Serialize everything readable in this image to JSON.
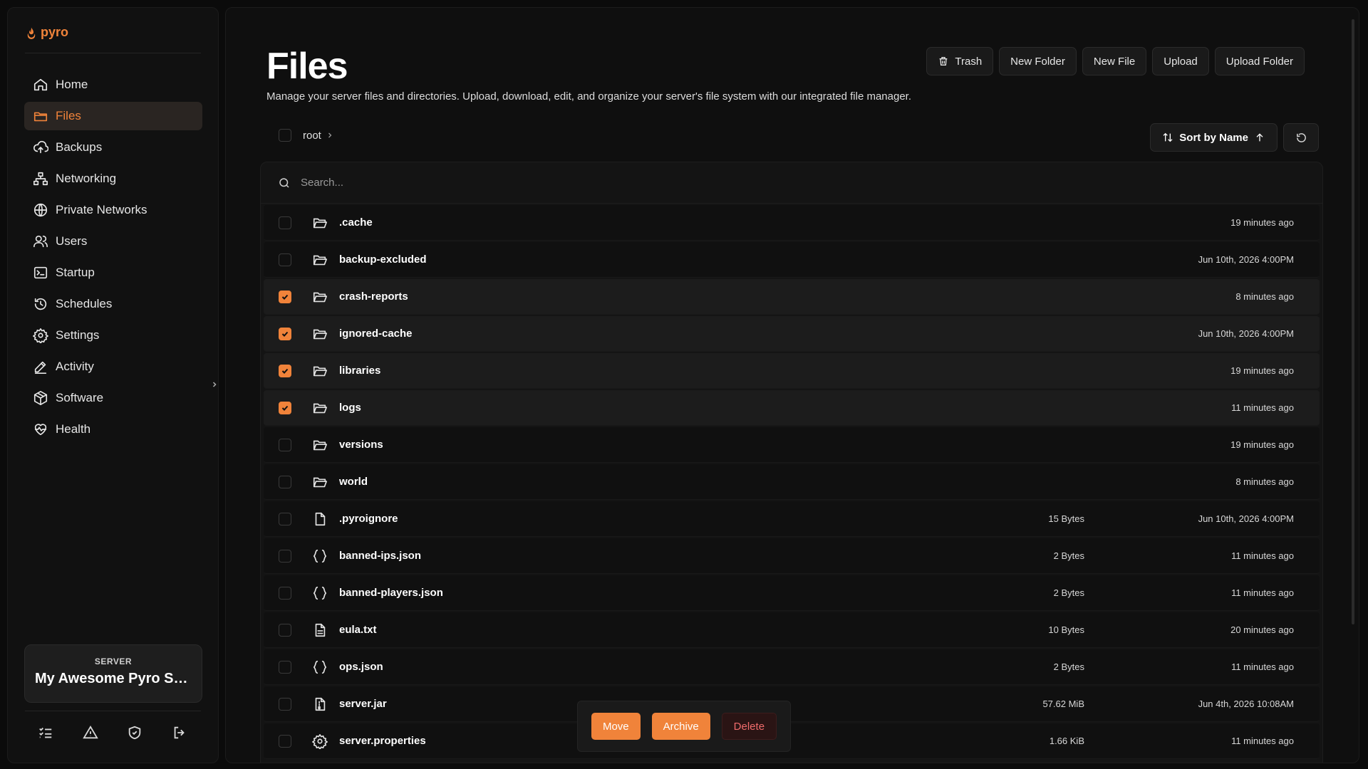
{
  "app": {
    "logo_text": "pyro",
    "brand_color": "#f0833a"
  },
  "sidebar": {
    "items": [
      {
        "label": "Home",
        "icon": "home-icon",
        "active": false
      },
      {
        "label": "Files",
        "icon": "folder-icon",
        "active": true
      },
      {
        "label": "Backups",
        "icon": "cloud-upload-icon",
        "active": false
      },
      {
        "label": "Networking",
        "icon": "network-icon",
        "active": false
      },
      {
        "label": "Private Networks",
        "icon": "globe-icon",
        "active": false
      },
      {
        "label": "Users",
        "icon": "users-icon",
        "active": false
      },
      {
        "label": "Startup",
        "icon": "terminal-icon",
        "active": false
      },
      {
        "label": "Schedules",
        "icon": "clock-icon",
        "active": false
      },
      {
        "label": "Settings",
        "icon": "gear-icon",
        "active": false
      },
      {
        "label": "Activity",
        "icon": "pen-icon",
        "active": false
      },
      {
        "label": "Software",
        "icon": "package-icon",
        "active": false
      },
      {
        "label": "Health",
        "icon": "heart-pulse-icon",
        "active": false
      }
    ],
    "server": {
      "label": "SERVER",
      "name": "My Awesome Pyro Se..."
    }
  },
  "page": {
    "title": "Files",
    "subtitle": "Manage your server files and directories. Upload, download, edit, and organize your server's file system with our integrated file manager."
  },
  "toolbar": {
    "trash": "Trash",
    "new_folder": "New Folder",
    "new_file": "New File",
    "upload": "Upload",
    "upload_folder": "Upload Folder"
  },
  "breadcrumb": {
    "root": "root"
  },
  "sort": {
    "label": "Sort by Name"
  },
  "search": {
    "placeholder": "Search..."
  },
  "files": [
    {
      "name": ".cache",
      "type": "folder",
      "size": "",
      "date": "19 minutes ago",
      "selected": false
    },
    {
      "name": "backup-excluded",
      "type": "folder",
      "size": "",
      "date": "Jun 10th, 2026 4:00PM",
      "selected": false
    },
    {
      "name": "crash-reports",
      "type": "folder",
      "size": "",
      "date": "8 minutes ago",
      "selected": true
    },
    {
      "name": "ignored-cache",
      "type": "folder",
      "size": "",
      "date": "Jun 10th, 2026 4:00PM",
      "selected": true
    },
    {
      "name": "libraries",
      "type": "folder",
      "size": "",
      "date": "19 minutes ago",
      "selected": true
    },
    {
      "name": "logs",
      "type": "folder",
      "size": "",
      "date": "11 minutes ago",
      "selected": true
    },
    {
      "name": "versions",
      "type": "folder",
      "size": "",
      "date": "19 minutes ago",
      "selected": false
    },
    {
      "name": "world",
      "type": "folder",
      "size": "",
      "date": "8 minutes ago",
      "selected": false
    },
    {
      "name": ".pyroignore",
      "type": "file",
      "size": "15 Bytes",
      "date": "Jun 10th, 2026 4:00PM",
      "selected": false
    },
    {
      "name": "banned-ips.json",
      "type": "json",
      "size": "2 Bytes",
      "date": "11 minutes ago",
      "selected": false
    },
    {
      "name": "banned-players.json",
      "type": "json",
      "size": "2 Bytes",
      "date": "11 minutes ago",
      "selected": false
    },
    {
      "name": "eula.txt",
      "type": "text",
      "size": "10 Bytes",
      "date": "20 minutes ago",
      "selected": false
    },
    {
      "name": "ops.json",
      "type": "json",
      "size": "2 Bytes",
      "date": "11 minutes ago",
      "selected": false
    },
    {
      "name": "server.jar",
      "type": "archive",
      "size": "57.62 MiB",
      "date": "Jun 4th, 2026 10:08AM",
      "selected": false
    },
    {
      "name": "server.properties",
      "type": "config",
      "size": "1.66 KiB",
      "date": "11 minutes ago",
      "selected": false
    }
  ],
  "actions": {
    "move": "Move",
    "archive": "Archive",
    "delete": "Delete"
  }
}
